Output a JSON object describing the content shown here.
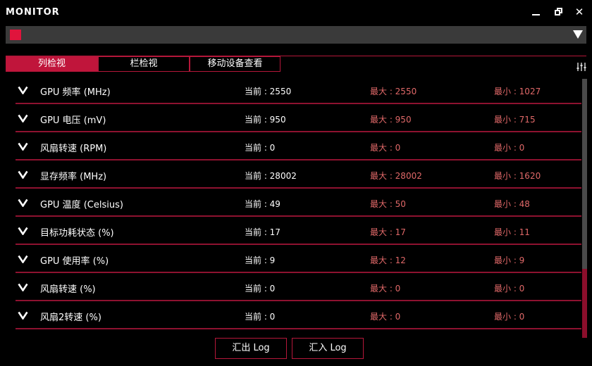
{
  "app": {
    "title": "MONITOR"
  },
  "window": {
    "minimize_icon": "minimize-icon",
    "restore_icon": "restore-icon",
    "close_icon": "close-icon",
    "close_glyph": "✕"
  },
  "device_selector": {
    "swatch_color": "#e0143c",
    "arrow_icon": "triangle-down-icon"
  },
  "tabs": [
    {
      "label": "列检视",
      "active": true
    },
    {
      "label": "栏检视",
      "active": false
    },
    {
      "label": "移动设备查看",
      "active": false
    }
  ],
  "settings_icon": "sliders-icon",
  "colors": {
    "accent": "#c0153b",
    "divider": "#8e1230",
    "minmax_text": "#e06868"
  },
  "metrics": [
    {
      "name": "GPU 频率 (MHz)",
      "current": "当前 : 2550",
      "max": "最大 : 2550",
      "min": "最小 : 1027"
    },
    {
      "name": "GPU 电压 (mV)",
      "current": "当前 : 950",
      "max": "最大 : 950",
      "min": "最小 : 715"
    },
    {
      "name": "风扇转速 (RPM)",
      "current": "当前 : 0",
      "max": "最大 : 0",
      "min": "最小 : 0"
    },
    {
      "name": "显存频率 (MHz)",
      "current": "当前 : 28002",
      "max": "最大 : 28002",
      "min": "最小 : 1620"
    },
    {
      "name": "GPU 温度 (Celsius)",
      "current": "当前 : 49",
      "max": "最大 : 50",
      "min": "最小 : 48"
    },
    {
      "name": "目标功耗状态 (%)",
      "current": "当前 : 17",
      "max": "最大 : 17",
      "min": "最小 : 11"
    },
    {
      "name": "GPU 使用率 (%)",
      "current": "当前 : 9",
      "max": "最大 : 12",
      "min": "最小 : 9"
    },
    {
      "name": "风扇转速 (%)",
      "current": "当前 : 0",
      "max": "最大 : 0",
      "min": "最小 : 0"
    },
    {
      "name": "风扇2转速 (%)",
      "current": "当前 : 0",
      "max": "最大 : 0",
      "min": "最小 : 0"
    }
  ],
  "footer": {
    "export_label": "汇出 Log",
    "import_label": "汇入 Log"
  }
}
